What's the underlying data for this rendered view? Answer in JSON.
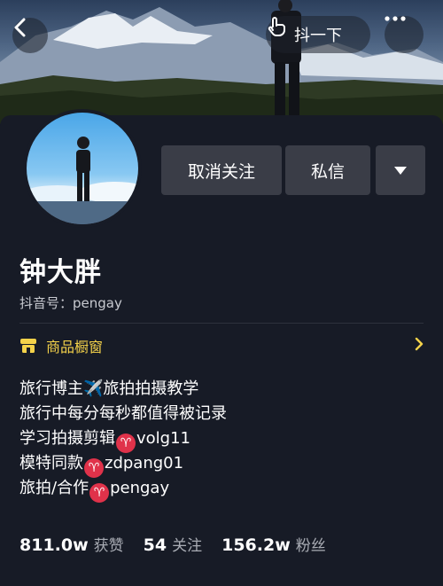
{
  "header": {
    "poke_label": "抖一下",
    "icons": {
      "back": "chevron-left-icon",
      "poke": "hand-pointer-icon",
      "more": "ellipsis-icon"
    }
  },
  "profile": {
    "name": "钟大胖",
    "douyin_id_label": "抖音号：",
    "douyin_id": "pengay"
  },
  "actions": {
    "unfollow_label": "取消关注",
    "message_label": "私信",
    "dropdown_icon": "triangle-down-icon"
  },
  "shop": {
    "label": "商品橱窗",
    "icon": "shop-icon",
    "color": "#f4d24a"
  },
  "bio": {
    "line1_a": "旅行博主",
    "line1_b": "旅拍拍摄教学",
    "line2": "旅行中每分每秒都值得被记录",
    "line3_a": "学习拍摄剪辑",
    "line3_b": "volg11",
    "line4_a": "模特同款",
    "line4_b": "zdpang01",
    "line5_a": "旅拍/合作",
    "line5_b": "pengay",
    "airplane_glyph": "✈️",
    "aries_glyph": "♈"
  },
  "stats": {
    "likes_value": "811.0w",
    "likes_label": "获赞",
    "following_value": "54",
    "following_label": "关注",
    "fans_value": "156.2w",
    "fans_label": "粉丝"
  },
  "colors": {
    "background": "#171b26",
    "button": "#3a3d47",
    "accent": "#f4d24a",
    "badge": "#e0324a"
  }
}
